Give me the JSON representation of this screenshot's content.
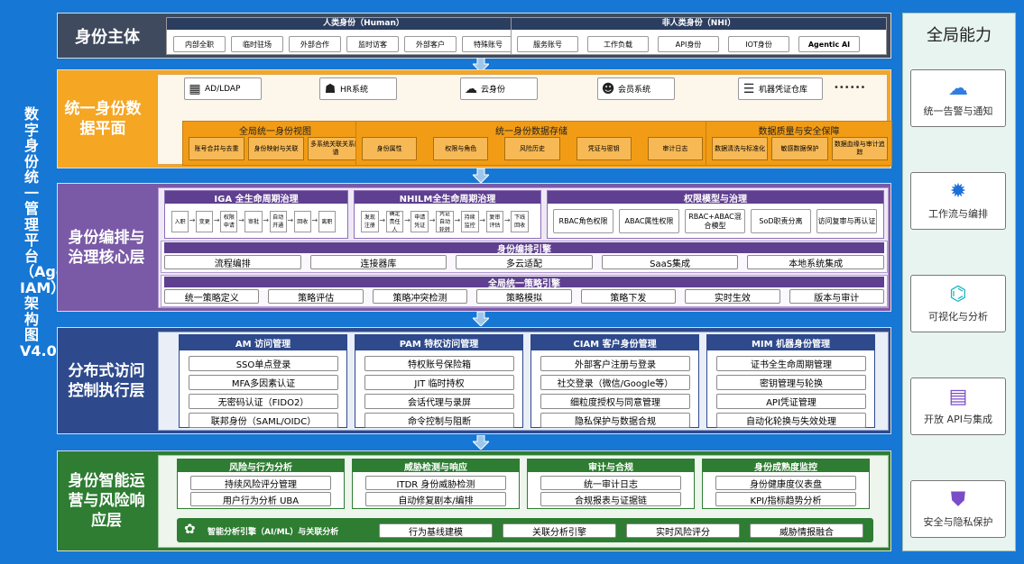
{
  "title": "数字身份统一管理平台（Agent IAM）架构图V4.0",
  "global": {
    "title": "全局能力",
    "items": [
      {
        "label": "统一告警与通知",
        "icon": "cloud-icon"
      },
      {
        "label": "工作流与编排",
        "icon": "gear-icon"
      },
      {
        "label": "可视化与分析",
        "icon": "network-icon"
      },
      {
        "label": "开放 API与集成",
        "icon": "document-icon"
      },
      {
        "label": "安全与隐私保护",
        "icon": "shield-icon"
      }
    ]
  },
  "layers": {
    "identity": {
      "label": "身份主体",
      "human": {
        "title": "人类身份（Human）",
        "items": [
          "内部全职",
          "临时驻场",
          "外部合作",
          "监时访客",
          "外部客户",
          "特殊账号"
        ]
      },
      "nhi": {
        "title": "非人类身份（NHI）",
        "items": [
          "服务账号",
          "工作负载",
          "API身份",
          "IOT身份",
          "Agentic AI"
        ]
      }
    },
    "data": {
      "label": "统一身份数据平面",
      "sources": [
        "AD/LDAP",
        "HR系统",
        "云身份",
        "会员系统",
        "机器凭证仓库"
      ],
      "more": "••••••",
      "groups": [
        {
          "title": "全局统一身份视图",
          "items": [
            "账号合并与去重",
            "身份映射与关联",
            "多系统关联关系图谱"
          ]
        },
        {
          "title": "统一身份数据存储",
          "items": [
            "身份属性",
            "权限与角色",
            "风险历史",
            "凭证与密钥",
            "审计日志"
          ]
        },
        {
          "title": "数据质量与安全保障",
          "items": [
            "数据清洗与标准化",
            "敏感数据保护",
            "数据血缘与审计追踪"
          ]
        }
      ]
    },
    "gov": {
      "label": "身份编排与治理核心层",
      "iga": {
        "title": "IGA 全生命周期治理",
        "steps": [
          "入职",
          "变更",
          "权限申请",
          "审批",
          "自动开通",
          "回收",
          "离职"
        ]
      },
      "nhilm": {
        "title": "NHILM全生命周期治理",
        "steps": [
          "发现注册",
          "确定责任人",
          "申请凭证",
          "凭证自动轮转",
          "持续监控",
          "复审评估",
          "下线回收"
        ]
      },
      "perm": {
        "title": "权限模型与治理",
        "items": [
          "RBAC角色权限",
          "ABAC属性权限",
          "RBAC+ABAC混合模型",
          "SoD职责分离",
          "访问复审与再认证"
        ]
      },
      "orch": {
        "title": "身份编排引擎",
        "items": [
          "流程编排",
          "连接器库",
          "多云适配",
          "SaaS集成",
          "本地系统集成"
        ]
      },
      "policy": {
        "title": "全局统一策略引擎",
        "items": [
          "统一策略定义",
          "策略评估",
          "策略冲突检测",
          "策略模拟",
          "策略下发",
          "实时生效",
          "版本与审计"
        ]
      }
    },
    "access": {
      "label": "分布式访问控制执行层",
      "groups": [
        {
          "title": "AM 访问管理",
          "items": [
            "SSO单点登录",
            "MFA多因素认证",
            "无密码认证（FIDO2）",
            "联邦身份（SAML/OIDC）"
          ]
        },
        {
          "title": "PAM 特权访问管理",
          "items": [
            "特权账号保险箱",
            "JIT 临时持权",
            "会话代理与录屏",
            "命令控制与阻断"
          ]
        },
        {
          "title": "CIAM 客户身份管理",
          "items": [
            "外部客户注册与登录",
            "社交登录（微信/Google等）",
            "细粒度授权与同意管理",
            "隐私保护与数据合规"
          ]
        },
        {
          "title": "MIM 机器身份管理",
          "items": [
            "证书全生命周期管理",
            "密钥管理与轮换",
            "API凭证管理",
            "自动化轮换与失效处理"
          ]
        }
      ]
    },
    "ops": {
      "label": "身份智能运营与风险响应层",
      "groups": [
        {
          "title": "风险与行为分析",
          "items": [
            "持续风险评分管理",
            "用户行为分析 UBA"
          ]
        },
        {
          "title": "威胁检测与响应",
          "items": [
            "ITDR 身份威胁检测",
            "自动修复剧本/编排"
          ]
        },
        {
          "title": "审计与合规",
          "items": [
            "统一审计日志",
            "合规报表与证据链"
          ]
        },
        {
          "title": "身份成熟度监控",
          "items": [
            "身份健康度仪表盘",
            "KPI/指标趋势分析"
          ]
        }
      ],
      "engine": {
        "title": "智能分析引擎（AI/ML）与关联分析",
        "items": [
          "行为基线建模",
          "关联分析引擎",
          "实时风险评分",
          "威胁情报融合"
        ]
      }
    }
  },
  "colors": {
    "blue": "#1677d4",
    "orange": "#f5a623",
    "purple": "#7a5aa6",
    "navy": "#2e4a8c",
    "green": "#2e7d32"
  }
}
